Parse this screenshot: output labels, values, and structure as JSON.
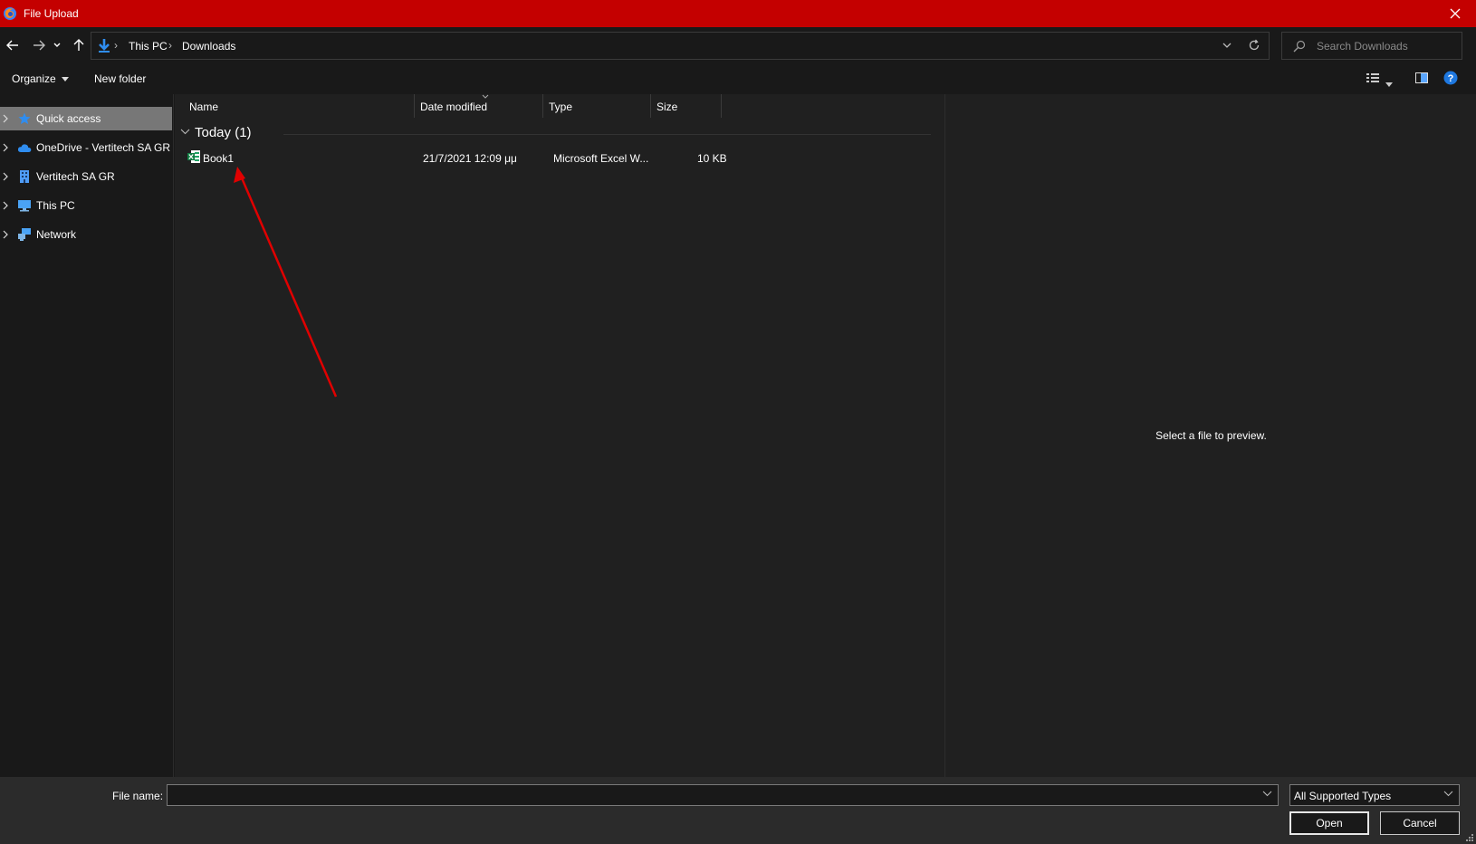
{
  "window": {
    "title": "File Upload",
    "app_icon": "firefox-icon",
    "close_icon": "close-icon",
    "accent_color": "#c40000"
  },
  "address": {
    "location_icon": "downloads-icon",
    "crumbs": [
      "This PC",
      "Downloads"
    ],
    "separator": "›"
  },
  "search": {
    "placeholder": "Search Downloads"
  },
  "toolbar": {
    "organize_label": "Organize",
    "new_folder_label": "New folder"
  },
  "sidebar": {
    "items": [
      {
        "label": "Quick access",
        "icon": "star-icon",
        "selected": true
      },
      {
        "label": "OneDrive - Vertitech SA GR",
        "icon": "cloud-icon"
      },
      {
        "label": "Vertitech SA GR",
        "icon": "building-icon"
      },
      {
        "label": "This PC",
        "icon": "computer-icon"
      },
      {
        "label": "Network",
        "icon": "network-icon"
      }
    ]
  },
  "filelist": {
    "columns": [
      "Name",
      "Date modified",
      "Type",
      "Size"
    ],
    "group": {
      "label": "Today (1)"
    },
    "files": [
      {
        "name": "Book1",
        "date_modified": "21/7/2021 12:09 μμ",
        "type": "Microsoft Excel W...",
        "size": "10 KB",
        "icon": "excel-file-icon"
      }
    ]
  },
  "preview": {
    "message": "Select a file to preview."
  },
  "bottom": {
    "file_name_label": "File name:",
    "file_name_value": "",
    "file_type_selected": "All Supported Types",
    "open_label": "Open",
    "cancel_label": "Cancel"
  },
  "annotation": {
    "color": "#e00000"
  }
}
